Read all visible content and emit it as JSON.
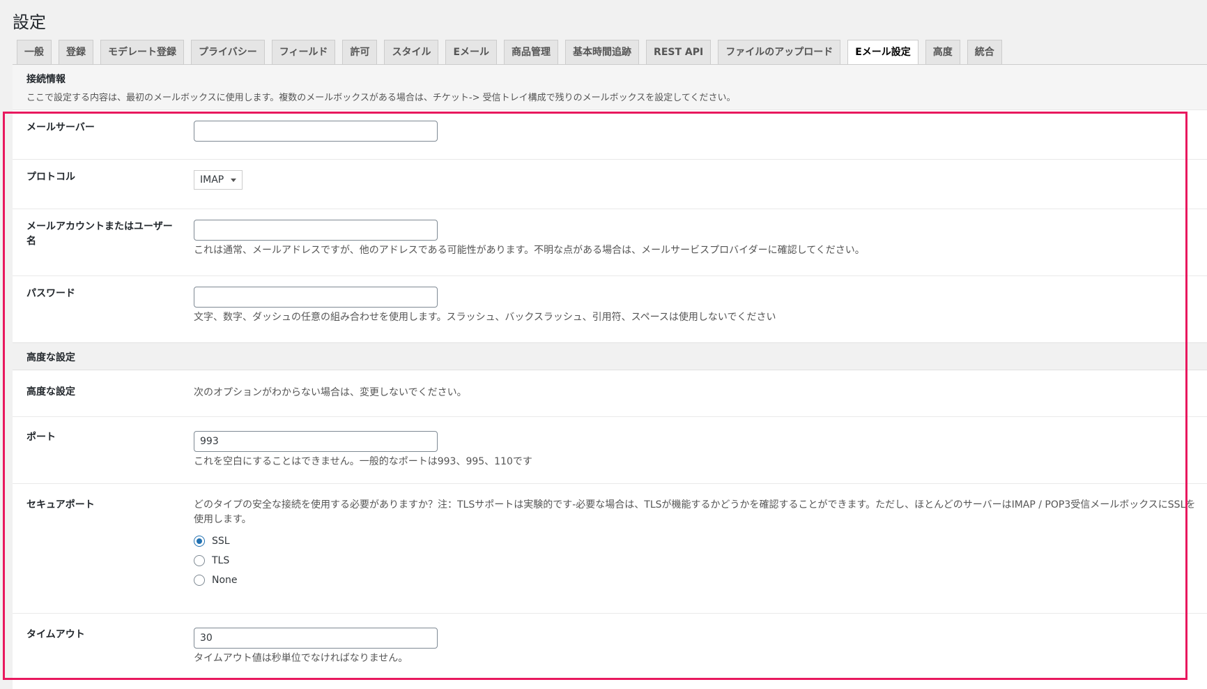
{
  "page_title": "設定",
  "tabs": [
    {
      "label": "一般"
    },
    {
      "label": "登録"
    },
    {
      "label": "モデレート登録"
    },
    {
      "label": "プライバシー"
    },
    {
      "label": "フィールド"
    },
    {
      "label": "許可"
    },
    {
      "label": "スタイル"
    },
    {
      "label": "Eメール"
    },
    {
      "label": "商品管理"
    },
    {
      "label": "基本時間追跡"
    },
    {
      "label": "REST API"
    },
    {
      "label": "ファイルのアップロード"
    },
    {
      "label": "Eメール設定"
    },
    {
      "label": "高度"
    },
    {
      "label": "統合"
    }
  ],
  "active_tab": "Eメール設定",
  "connection": {
    "title": "接続情報",
    "description": "ここで設定する内容は、最初のメールボックスに使用します。複数のメールボックスがある場合は、チケット-> 受信トレイ構成で残りのメールボックスを設定してください。"
  },
  "fields": {
    "mail_server": {
      "label": "メールサーバー",
      "value": ""
    },
    "protocol": {
      "label": "プロトコル",
      "value": "IMAP"
    },
    "account": {
      "label": "メールアカウントまたはユーザー名",
      "value": "",
      "hint": "これは通常、メールアドレスですが、他のアドレスである可能性があります。不明な点がある場合は、メールサービスプロバイダーに確認してください。"
    },
    "password": {
      "label": "パスワード",
      "value": "",
      "hint": "文字、数字、ダッシュの任意の組み合わせを使用します。スラッシュ、バックスラッシュ、引用符、スペースは使用しないでください"
    }
  },
  "advanced": {
    "section_title": "高度な設定",
    "row_label": "高度な設定",
    "row_text": "次のオプションがわからない場合は、変更しないでください。",
    "port": {
      "label": "ポート",
      "value": "993",
      "hint": "これを空白にすることはできません。一般的なポートは993、995、110です"
    },
    "secure_port": {
      "label": "セキュアポート",
      "hint": "どのタイプの安全な接続を使用する必要がありますか？注：TLSサポートは実験的です-必要な場合は、TLSが機能するかどうかを確認することができます。ただし、ほとんどのサーバーはIMAP / POP3受信メールボックスにSSLを使用します。",
      "options": [
        {
          "label": "SSL",
          "checked": true
        },
        {
          "label": "TLS",
          "checked": false
        },
        {
          "label": "None",
          "checked": false
        }
      ]
    },
    "timeout": {
      "label": "タイムアウト",
      "value": "30",
      "hint": "タイムアウト値は秒単位でなければなりません。"
    }
  },
  "colors": {
    "highlight": "#e8185e",
    "accent": "#2271b1"
  }
}
